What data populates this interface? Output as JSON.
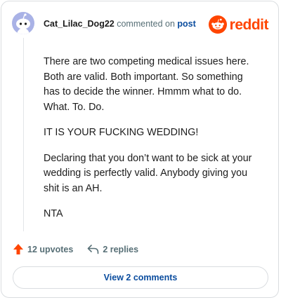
{
  "comment": {
    "username": "Cat_Lilac_Dog22",
    "action_text": "commented on",
    "post_link": "post",
    "paragraphs": [
      "There are two competing medical issues here. Both are valid. Both important. So something has to decide the winner. Hmmm what to do. What. To. Do.",
      "IT IS YOUR FUCKING WEDDING!",
      "Declaring that you don’t want to be sick at your wedding is perfectly valid. Anybody giving you shit is an AH.",
      "NTA"
    ]
  },
  "brand": {
    "wordmark": "reddit",
    "logo_icon": "reddit-snoo-icon",
    "color": "#ff4500"
  },
  "avatar": {
    "icon": "snoo-avatar-icon",
    "color": "#a9b2e6"
  },
  "actions": {
    "upvotes_label": "12 upvotes",
    "upvote_icon": "upvote-arrow-icon",
    "upvote_color": "#ff4500",
    "replies_label": "2 replies",
    "reply_icon": "reply-arrow-icon"
  },
  "footer": {
    "view_comments_label": "View 2 comments"
  }
}
